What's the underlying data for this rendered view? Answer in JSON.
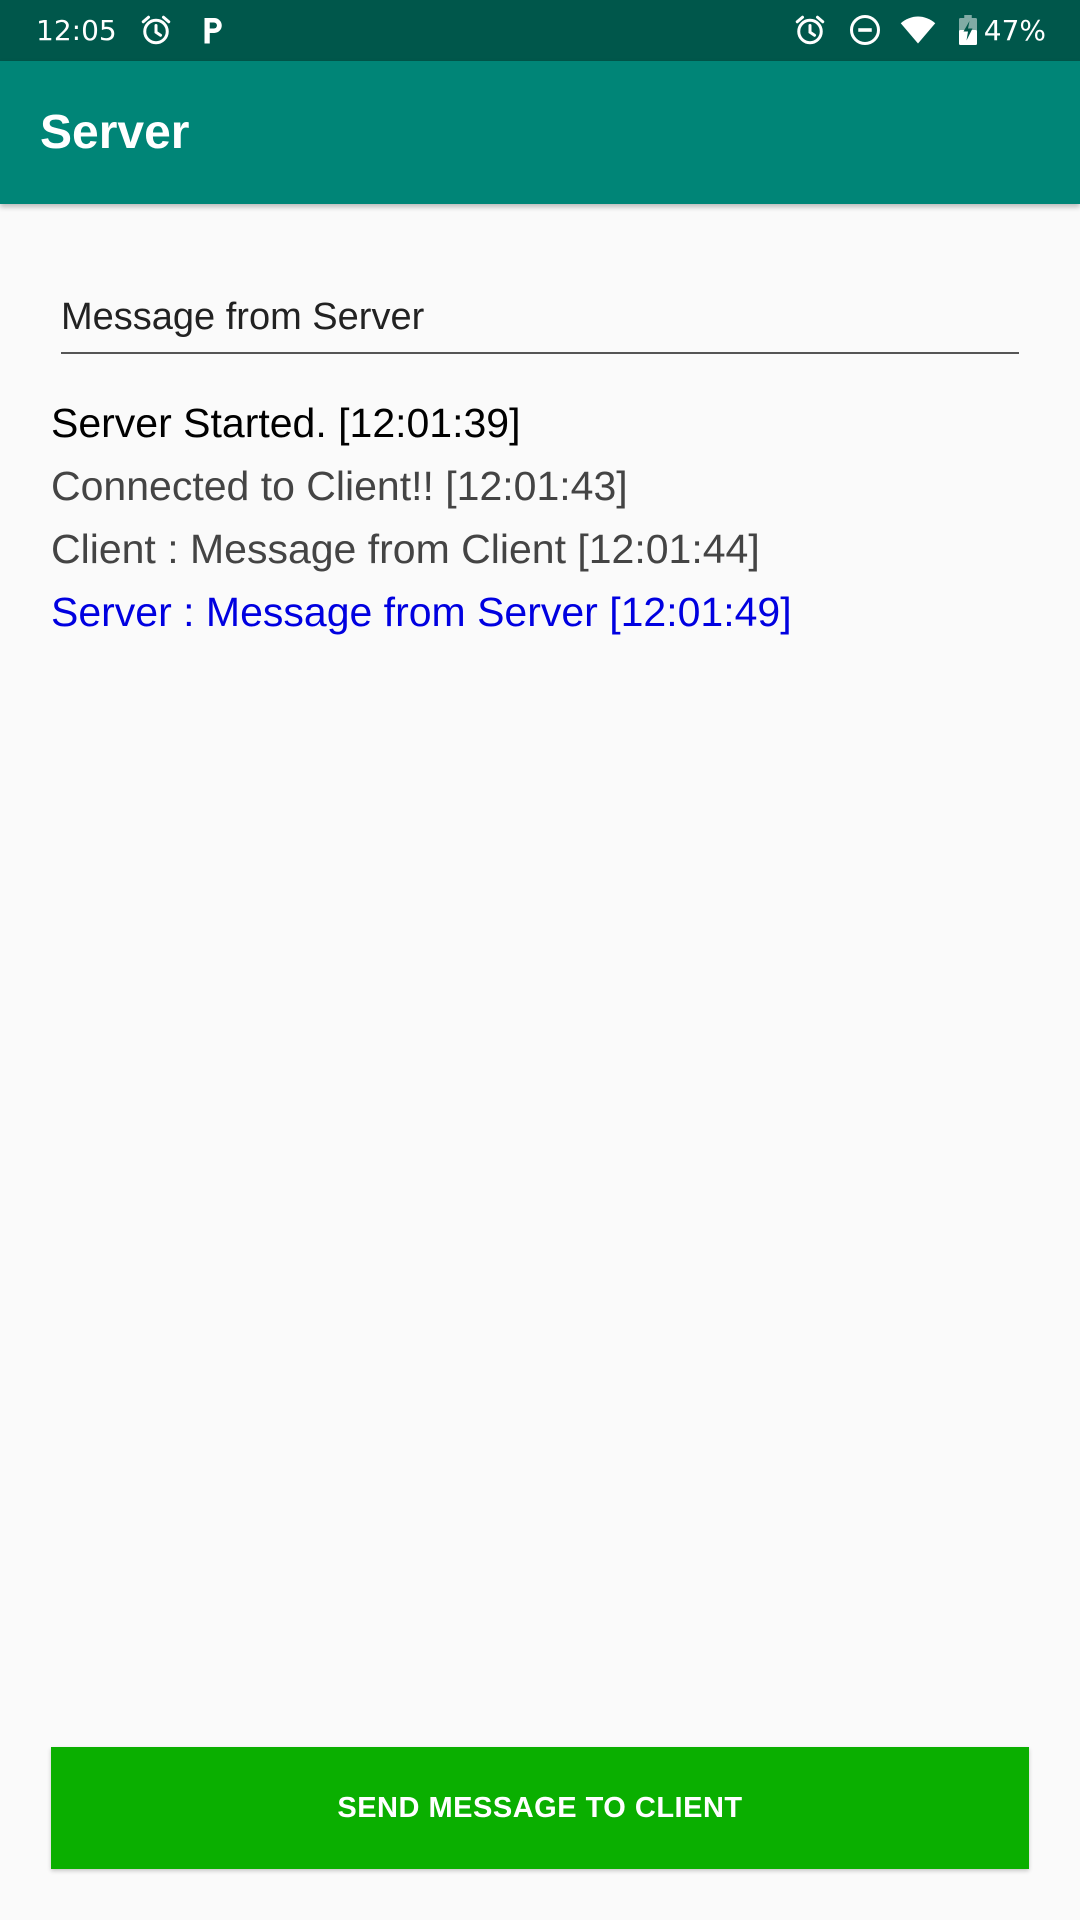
{
  "status_bar": {
    "time": "12:05",
    "battery": "47%",
    "icons": [
      "alarm-icon",
      "parking-p-icon",
      "alarm-icon",
      "do-not-disturb-icon",
      "wifi-icon",
      "battery-charging-icon"
    ]
  },
  "app_bar": {
    "title": "Server",
    "color": "#008577"
  },
  "message_input": {
    "value": "Message from Server"
  },
  "log": [
    {
      "text": "Server Started. [12:01:39]",
      "color": "#000000"
    },
    {
      "text": "Connected to Client!! [12:01:43]",
      "color": "#444444"
    },
    {
      "text": "Client : Message from Client [12:01:44]",
      "color": "#444444"
    },
    {
      "text": "Server : Message from Server [12:01:49]",
      "color": "#0000e0"
    }
  ],
  "send_button": {
    "label": "SEND MESSAGE TO CLIENT",
    "color": "#0aaf00"
  }
}
